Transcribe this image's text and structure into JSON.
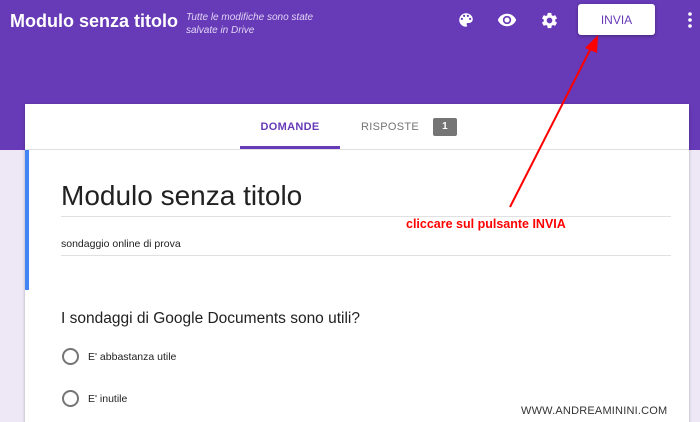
{
  "header": {
    "title": "Modulo senza titolo",
    "save_status": "Tutte le modifiche sono state salvate in Drive",
    "icons": [
      "palette-icon",
      "eye-icon",
      "gear-icon",
      "more-vert-icon"
    ],
    "send_label": "INVIA",
    "background_color": "#673ab7"
  },
  "tabs": {
    "questions_label": "DOMANDE",
    "responses_label": "RISPOSTE",
    "responses_count": "1"
  },
  "form": {
    "title": "Modulo senza titolo",
    "description": "sondaggio online di prova",
    "question": "I sondaggi di Google Documents sono utili?",
    "options": [
      "E' abbastanza utile",
      "E' inutile"
    ]
  },
  "annotation": {
    "text": "cliccare sul pulsante INVIA",
    "color": "#ff0000"
  },
  "watermark": "WWW.ANDREAMININI.COM"
}
